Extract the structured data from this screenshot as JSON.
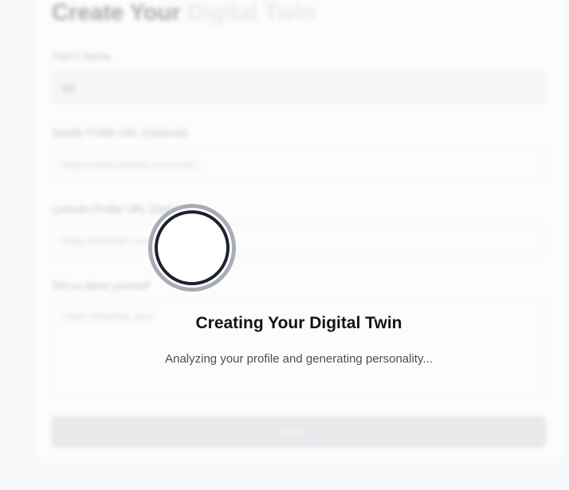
{
  "form": {
    "title_main": "Create Your",
    "title_accent": "Digital Twin",
    "name_label": "Twin's Name",
    "name_value": "bill",
    "spotify_label": "Spotify Profile URL (Optional)",
    "spotify_placeholder": "https://open.spotify.com/user/...",
    "linkedin_label": "LinkedIn Profile URL (Optional)",
    "linkedin_placeholder": "https://linkedin.com/in/...",
    "about_label": "Tell us about yourself",
    "about_placeholder": "I love bingeing Jazz",
    "submit_label": "Next →"
  },
  "loading": {
    "title": "Creating Your Digital Twin",
    "subtitle": "Analyzing your profile and generating personality..."
  },
  "colors": {
    "spinner_ring": "#1c2130",
    "spinner_track": "#a9acb2",
    "overlay": "#ffffff"
  }
}
